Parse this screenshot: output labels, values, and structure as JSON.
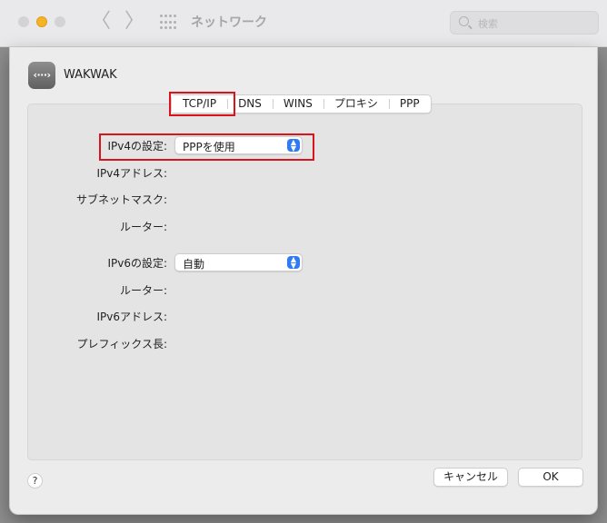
{
  "window": {
    "title": "ネットワーク",
    "search_placeholder": "検索",
    "nav_back": "〈",
    "nav_forward": "〉"
  },
  "service": {
    "icon_text": "‹···›",
    "name": "WAKWAK"
  },
  "tabs": [
    {
      "label": "TCP/IP",
      "selected": true
    },
    {
      "label": "DNS",
      "selected": false
    },
    {
      "label": "WINS",
      "selected": false
    },
    {
      "label": "プロキシ",
      "selected": false
    },
    {
      "label": "PPP",
      "selected": false
    }
  ],
  "ipv4": {
    "config_label": "IPv4の設定:",
    "config_value": "PPPを使用",
    "address_label": "IPv4アドレス:",
    "subnet_label": "サブネットマスク:",
    "router_label": "ルーター:"
  },
  "ipv6": {
    "config_label": "IPv6の設定:",
    "config_value": "自動",
    "router_label": "ルーター:",
    "address_label": "IPv6アドレス:",
    "prefix_label": "プレフィックス長:"
  },
  "buttons": {
    "help": "?",
    "cancel": "キャンセル",
    "ok": "OK"
  },
  "colors": {
    "accent": "#2f7bf6",
    "highlight": "#d9141c"
  }
}
